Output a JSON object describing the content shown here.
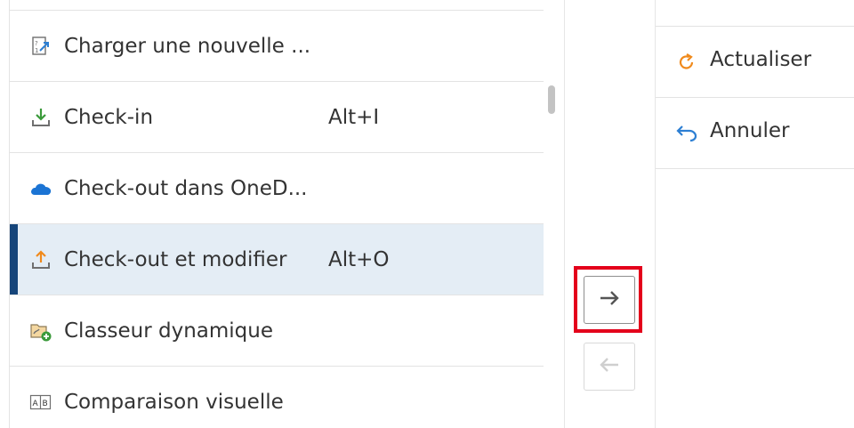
{
  "available_commands": [
    {
      "label": "Charger une nouvelle ...",
      "shortcut": "",
      "icon": "upload-new-version-icon",
      "selected": false
    },
    {
      "label": "Check-in",
      "shortcut": "Alt+I",
      "icon": "check-in-icon",
      "selected": false
    },
    {
      "label": "Check-out dans OneD...",
      "shortcut": "",
      "icon": "onedrive-cloud-icon",
      "selected": false
    },
    {
      "label": "Check-out et modifier",
      "shortcut": "Alt+O",
      "icon": "check-out-edit-icon",
      "selected": true
    },
    {
      "label": "Classeur dynamique",
      "shortcut": "",
      "icon": "dynamic-folder-icon",
      "selected": false
    },
    {
      "label": "Comparaison visuelle",
      "shortcut": "",
      "icon": "visual-comparison-icon",
      "selected": false
    }
  ],
  "transfer_buttons": {
    "add": {
      "icon": "arrow-right-icon",
      "enabled": true,
      "highlighted": true
    },
    "remove": {
      "icon": "arrow-left-icon",
      "enabled": false
    }
  },
  "selected_commands": [
    {
      "label": "Actualiser",
      "icon": "refresh-icon"
    },
    {
      "label": "Annuler",
      "icon": "undo-icon"
    }
  ],
  "colors": {
    "selection_bg": "#e4edf5",
    "selection_bar": "#16457a",
    "highlight": "#e4001b",
    "onedrive": "#1b74d4",
    "refresh": "#f08a1c",
    "undo": "#2d7fd3",
    "checkin": "#3a9a3a",
    "checkout": "#f08a1c"
  }
}
